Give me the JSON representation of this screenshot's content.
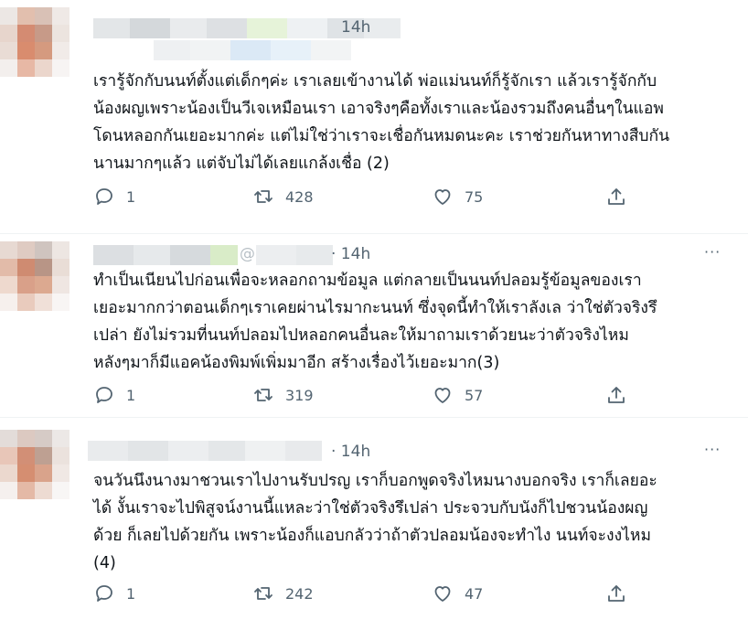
{
  "tweets": [
    {
      "time": "14h",
      "more": "···",
      "text": "เรารู้จักกับนนท์ตั้งแต่เด็กๆค่ะ เราเลยเข้างานได้ พ่อแม่นนท์ก็รู้จักเรา แล้วเรารู้จักกับ\nน้องผญเพราะน้องเป็นวีเจเหมือนเรา เอาจริงๆคือทั้งเราและน้องรวมถึงคนอื่นๆในแอพ\nโดนหลอกกันเยอะมากค่ะ แต่ไม่ใช่ว่าเราจะเชื่อกันหมดนะคะ เราช่วยกันหาทางสืบกัน\nนานมากๆแล้ว แต่จับไม่ได้เลยแกล้งเชื่อ (2)",
      "replies": "1",
      "retweets": "428",
      "likes": "75"
    },
    {
      "time": "· 14h",
      "handle_fragment": "@",
      "more": "···",
      "text": "ทำเป็นเนียนไปก่อนเพื่อจะหลอกถามข้อมูล แต่กลายเป็นนนท์ปลอมรู้ข้อมูลของเรา\nเยอะมากกว่าตอนเด็กๆเราเคยผ่านไรมากะนนท์ ซึ่งจุดนี้ทำให้เราลังเล ว่าใช่ตัวจริงรึ\nเปล่า ยังไม่รวมที่นนท์ปลอมไปหลอกคนอื่นละให้มาถามเราด้วยนะว่าตัวจริงไหม\nหลังๆมาก็มีแอคน้องพิมพ์เพิ่มมาอีก สร้างเรื่องไว้เยอะมาก(3)",
      "replies": "1",
      "retweets": "319",
      "likes": "57"
    },
    {
      "time": "· 14h",
      "more": "···",
      "text": "จนวันนึงนางมาชวนเราไปงานรับปรญ เราก็บอกพูดจริงไหมนางบอกจริง เราก็เลยอะ\nได้ งั้นเราจะไปพิสูจน์งานนี้แหละว่าใช่ตัวจริงรึเปล่า ประจวบกับนังก็ไปชวนน้องผญ\nด้วย ก็เลยไปด้วยกัน เพราะน้องก็แอบกลัวว่าถ้าตัวปลอมน้องจะทำไง นนท์จะงงไหม\n(4)",
      "replies": "1",
      "retweets": "242",
      "likes": "47"
    }
  ],
  "icons": {
    "reply": "reply-icon",
    "retweet": "retweet-icon",
    "like": "heart-icon",
    "share": "share-icon",
    "more": "more-icon"
  }
}
